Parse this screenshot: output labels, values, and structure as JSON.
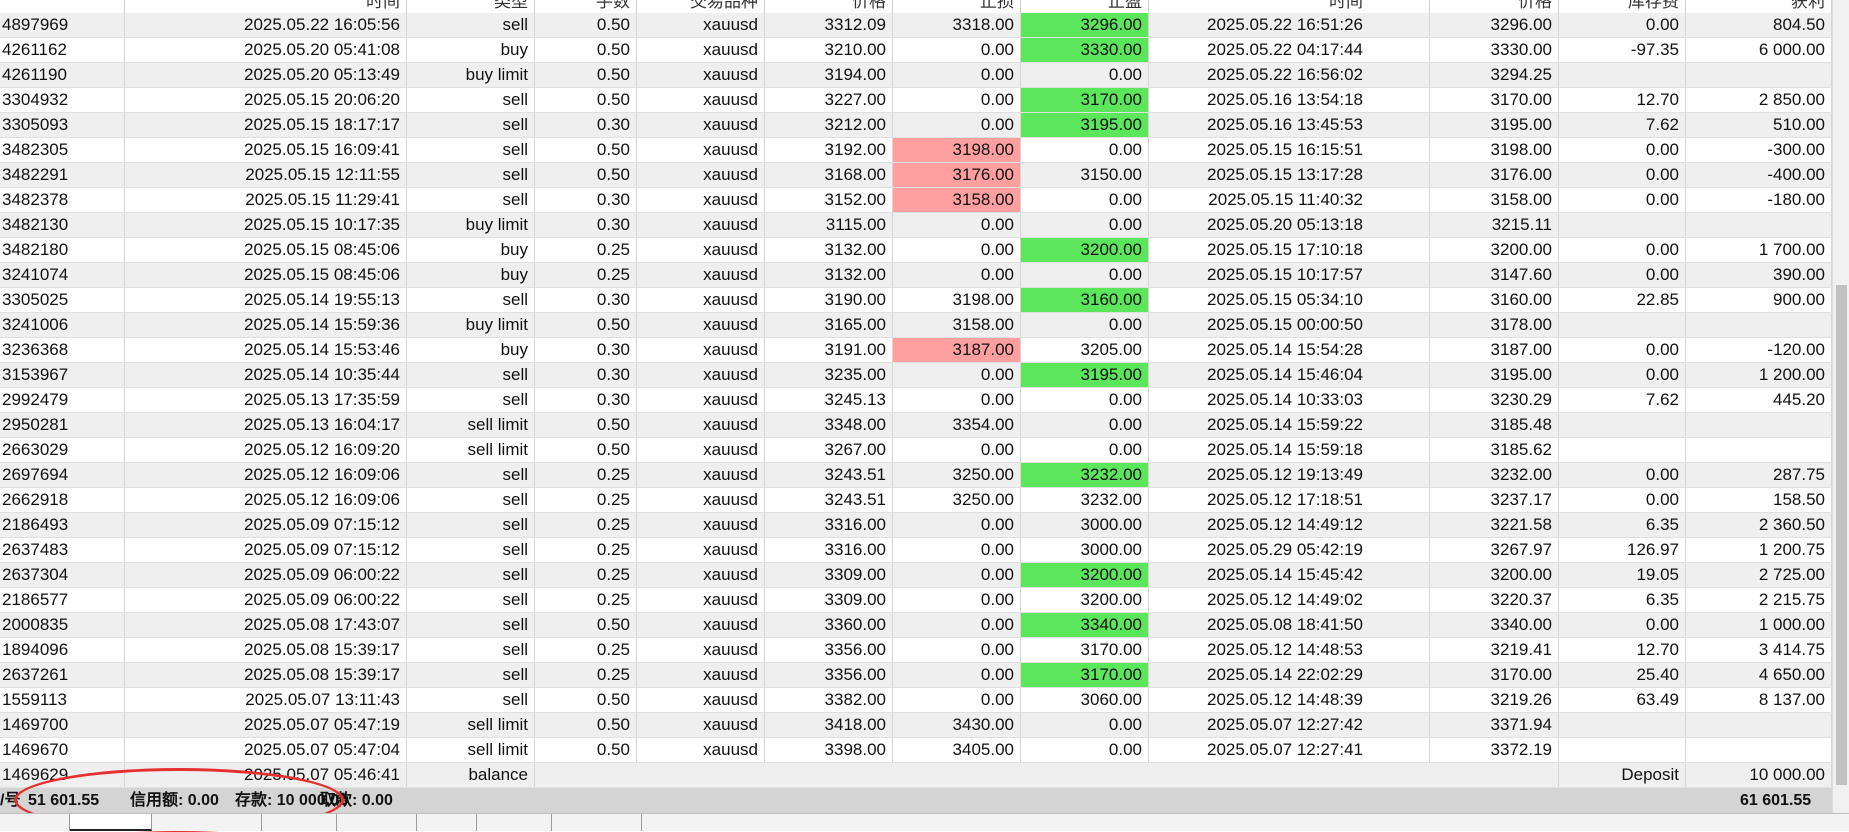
{
  "columns": [
    "时间",
    "类型",
    "手数",
    "交易品种",
    "价格",
    "止损",
    "止盈",
    "时间",
    "价格",
    "库存费",
    "获利"
  ],
  "rows": [
    [
      "4897969",
      "2025.05.22 16:05:56",
      "sell",
      "0.50",
      "xauusd",
      "3312.09",
      "3318.00",
      "3296.00",
      "2025.05.22 16:51:26",
      "3296.00",
      "0.00",
      "804.50",
      "",
      "g"
    ],
    [
      "4261162",
      "2025.05.20 05:41:08",
      "buy",
      "0.50",
      "xauusd",
      "3210.00",
      "0.00",
      "3330.00",
      "2025.05.22 04:17:44",
      "3330.00",
      "-97.35",
      "6 000.00",
      "",
      "g"
    ],
    [
      "4261190",
      "2025.05.20 05:13:49",
      "buy limit",
      "0.50",
      "xauusd",
      "3194.00",
      "0.00",
      "0.00",
      "2025.05.22 16:56:02",
      "3294.25",
      "",
      "",
      "",
      ""
    ],
    [
      "3304932",
      "2025.05.15 20:06:20",
      "sell",
      "0.50",
      "xauusd",
      "3227.00",
      "0.00",
      "3170.00",
      "2025.05.16 13:54:18",
      "3170.00",
      "12.70",
      "2 850.00",
      "",
      "g"
    ],
    [
      "3305093",
      "2025.05.15 18:17:17",
      "sell",
      "0.30",
      "xauusd",
      "3212.00",
      "0.00",
      "3195.00",
      "2025.05.16 13:45:53",
      "3195.00",
      "7.62",
      "510.00",
      "",
      "g"
    ],
    [
      "3482305",
      "2025.05.15 16:09:41",
      "sell",
      "0.50",
      "xauusd",
      "3192.00",
      "3198.00",
      "0.00",
      "2025.05.15 16:15:51",
      "3198.00",
      "0.00",
      "-300.00",
      "r",
      ""
    ],
    [
      "3482291",
      "2025.05.15 12:11:55",
      "sell",
      "0.50",
      "xauusd",
      "3168.00",
      "3176.00",
      "3150.00",
      "2025.05.15 13:17:28",
      "3176.00",
      "0.00",
      "-400.00",
      "r",
      ""
    ],
    [
      "3482378",
      "2025.05.15 11:29:41",
      "sell",
      "0.30",
      "xauusd",
      "3152.00",
      "3158.00",
      "0.00",
      "2025.05.15 11:40:32",
      "3158.00",
      "0.00",
      "-180.00",
      "r",
      ""
    ],
    [
      "3482130",
      "2025.05.15 10:17:35",
      "buy limit",
      "0.30",
      "xauusd",
      "3115.00",
      "0.00",
      "0.00",
      "2025.05.20 05:13:18",
      "3215.11",
      "",
      "",
      "",
      ""
    ],
    [
      "3482180",
      "2025.05.15 08:45:06",
      "buy",
      "0.25",
      "xauusd",
      "3132.00",
      "0.00",
      "3200.00",
      "2025.05.15 17:10:18",
      "3200.00",
      "0.00",
      "1 700.00",
      "",
      "g"
    ],
    [
      "3241074",
      "2025.05.15 08:45:06",
      "buy",
      "0.25",
      "xauusd",
      "3132.00",
      "0.00",
      "0.00",
      "2025.05.15 10:17:57",
      "3147.60",
      "0.00",
      "390.00",
      "",
      ""
    ],
    [
      "3305025",
      "2025.05.14 19:55:13",
      "sell",
      "0.30",
      "xauusd",
      "3190.00",
      "3198.00",
      "3160.00",
      "2025.05.15 05:34:10",
      "3160.00",
      "22.85",
      "900.00",
      "",
      "g"
    ],
    [
      "3241006",
      "2025.05.14 15:59:36",
      "buy limit",
      "0.50",
      "xauusd",
      "3165.00",
      "3158.00",
      "0.00",
      "2025.05.15 00:00:50",
      "3178.00",
      "",
      "",
      "",
      ""
    ],
    [
      "3236368",
      "2025.05.14 15:53:46",
      "buy",
      "0.30",
      "xauusd",
      "3191.00",
      "3187.00",
      "3205.00",
      "2025.05.14 15:54:28",
      "3187.00",
      "0.00",
      "-120.00",
      "r",
      ""
    ],
    [
      "3153967",
      "2025.05.14 10:35:44",
      "sell",
      "0.30",
      "xauusd",
      "3235.00",
      "0.00",
      "3195.00",
      "2025.05.14 15:46:04",
      "3195.00",
      "0.00",
      "1 200.00",
      "",
      "g"
    ],
    [
      "2992479",
      "2025.05.13 17:35:59",
      "sell",
      "0.30",
      "xauusd",
      "3245.13",
      "0.00",
      "0.00",
      "2025.05.14 10:33:03",
      "3230.29",
      "7.62",
      "445.20",
      "",
      ""
    ],
    [
      "2950281",
      "2025.05.13 16:04:17",
      "sell limit",
      "0.50",
      "xauusd",
      "3348.00",
      "3354.00",
      "0.00",
      "2025.05.14 15:59:22",
      "3185.48",
      "",
      "",
      "",
      ""
    ],
    [
      "2663029",
      "2025.05.12 16:09:20",
      "sell limit",
      "0.50",
      "xauusd",
      "3267.00",
      "0.00",
      "0.00",
      "2025.05.14 15:59:18",
      "3185.62",
      "",
      "",
      "",
      ""
    ],
    [
      "2697694",
      "2025.05.12 16:09:06",
      "sell",
      "0.25",
      "xauusd",
      "3243.51",
      "3250.00",
      "3232.00",
      "2025.05.12 19:13:49",
      "3232.00",
      "0.00",
      "287.75",
      "",
      "g"
    ],
    [
      "2662918",
      "2025.05.12 16:09:06",
      "sell",
      "0.25",
      "xauusd",
      "3243.51",
      "3250.00",
      "3232.00",
      "2025.05.12 17:18:51",
      "3237.17",
      "0.00",
      "158.50",
      "",
      ""
    ],
    [
      "2186493",
      "2025.05.09 07:15:12",
      "sell",
      "0.25",
      "xauusd",
      "3316.00",
      "0.00",
      "3000.00",
      "2025.05.12 14:49:12",
      "3221.58",
      "6.35",
      "2 360.50",
      "",
      ""
    ],
    [
      "2637483",
      "2025.05.09 07:15:12",
      "sell",
      "0.25",
      "xauusd",
      "3316.00",
      "0.00",
      "3000.00",
      "2025.05.29 05:42:19",
      "3267.97",
      "126.97",
      "1 200.75",
      "",
      ""
    ],
    [
      "2637304",
      "2025.05.09 06:00:22",
      "sell",
      "0.25",
      "xauusd",
      "3309.00",
      "0.00",
      "3200.00",
      "2025.05.14 15:45:42",
      "3200.00",
      "19.05",
      "2 725.00",
      "",
      "g"
    ],
    [
      "2186577",
      "2025.05.09 06:00:22",
      "sell",
      "0.25",
      "xauusd",
      "3309.00",
      "0.00",
      "3200.00",
      "2025.05.12 14:49:02",
      "3220.37",
      "6.35",
      "2 215.75",
      "",
      ""
    ],
    [
      "2000835",
      "2025.05.08 17:43:07",
      "sell",
      "0.50",
      "xauusd",
      "3360.00",
      "0.00",
      "3340.00",
      "2025.05.08 18:41:50",
      "3340.00",
      "0.00",
      "1 000.00",
      "",
      "g"
    ],
    [
      "1894096",
      "2025.05.08 15:39:17",
      "sell",
      "0.25",
      "xauusd",
      "3356.00",
      "0.00",
      "3170.00",
      "2025.05.12 14:48:53",
      "3219.41",
      "12.70",
      "3 414.75",
      "",
      ""
    ],
    [
      "2637261",
      "2025.05.08 15:39:17",
      "sell",
      "0.25",
      "xauusd",
      "3356.00",
      "0.00",
      "3170.00",
      "2025.05.14 22:02:29",
      "3170.00",
      "25.40",
      "4 650.00",
      "",
      "g"
    ],
    [
      "1559113",
      "2025.05.07 13:11:43",
      "sell",
      "0.50",
      "xauusd",
      "3382.00",
      "0.00",
      "3060.00",
      "2025.05.12 14:48:39",
      "3219.26",
      "63.49",
      "8 137.00",
      "",
      ""
    ],
    [
      "1469700",
      "2025.05.07 05:47:19",
      "sell limit",
      "0.50",
      "xauusd",
      "3418.00",
      "3430.00",
      "0.00",
      "2025.05.07 12:27:42",
      "3371.94",
      "",
      "",
      "",
      ""
    ],
    [
      "1469670",
      "2025.05.07 05:47:04",
      "sell limit",
      "0.50",
      "xauusd",
      "3398.00",
      "3405.00",
      "0.00",
      "2025.05.07 12:27:41",
      "3372.19",
      "",
      "",
      "",
      ""
    ]
  ],
  "balance_row": {
    "id": "1469629",
    "time": "2025.05.07 05:46:41",
    "type": "balance",
    "comment": "Deposit",
    "amount": "10 000.00"
  },
  "footer": {
    "label": "/号",
    "equity": "51 601.55",
    "credit": "信用额: 0.00",
    "deposit": "存款: 10 000.00",
    "withdraw": "取款: 0.00",
    "total": "61 601.55"
  },
  "colors": {
    "take_profit_hit": "#5ce65c",
    "stop_loss_hit": "#ff9f9f",
    "annotation_circle": "#e53030"
  }
}
